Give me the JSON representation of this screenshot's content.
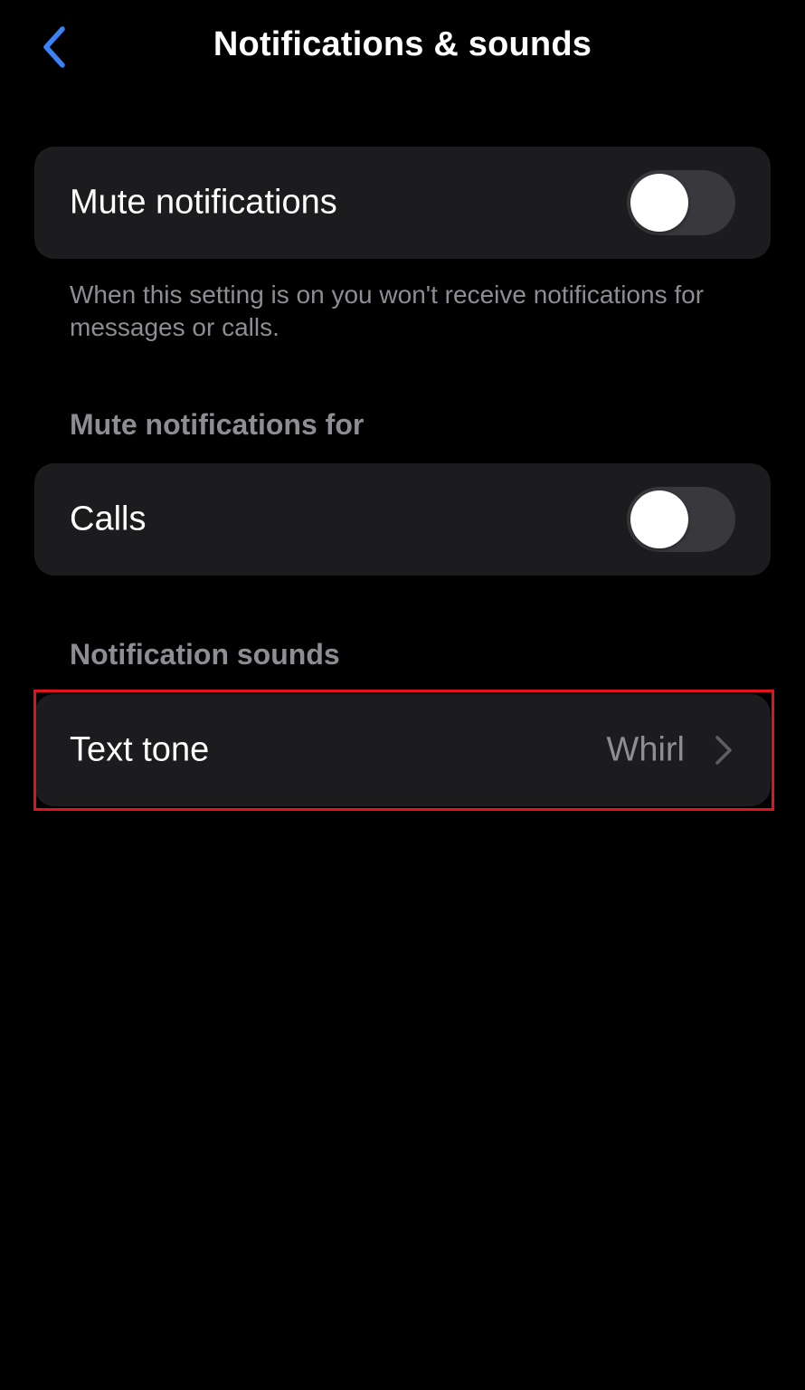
{
  "nav": {
    "title": "Notifications & sounds",
    "back_icon": "chevron-left-icon",
    "back_color": "#3b82f6"
  },
  "mute_notifications": {
    "label": "Mute notifications",
    "toggle_on": false,
    "footnote": "When this setting is on you won't receive notifications for messages or calls."
  },
  "mute_notifications_for": {
    "header": "Mute notifications for",
    "items": [
      {
        "label": "Calls",
        "toggle_on": false
      }
    ]
  },
  "notification_sounds": {
    "header": "Notification sounds",
    "items": [
      {
        "label": "Text tone",
        "value": "Whirl",
        "icon": "chevron-right-icon",
        "highlighted": true
      }
    ]
  },
  "colors": {
    "background": "#000000",
    "card": "#1c1c1e",
    "secondary_text": "#8d8d93",
    "toggle_off": "#39393d",
    "highlight": "#e0141e"
  }
}
